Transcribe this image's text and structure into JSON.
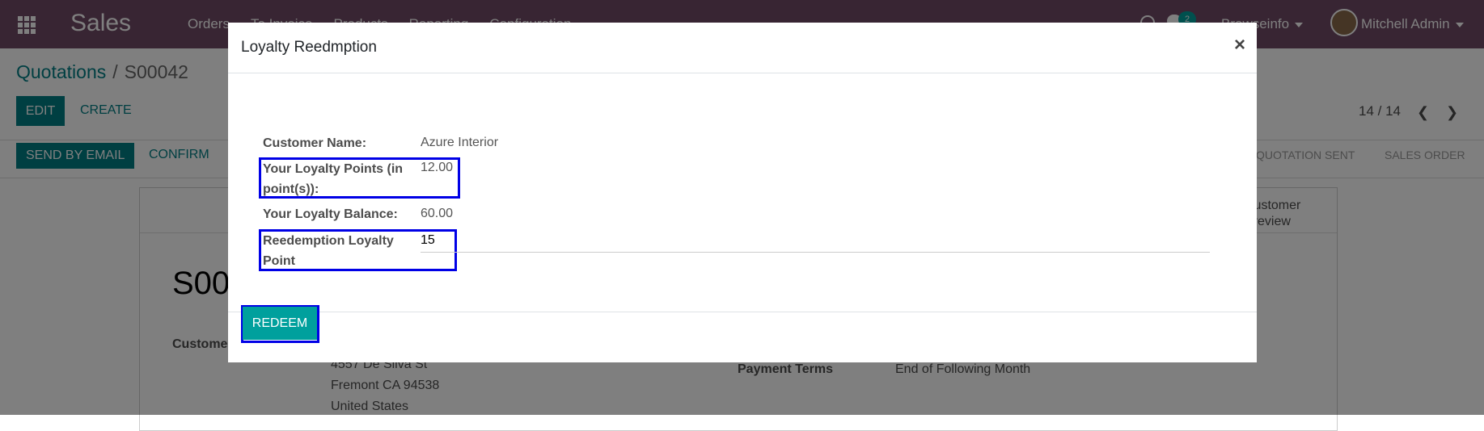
{
  "navbar": {
    "brand": "Sales",
    "menu": [
      "Orders",
      "To Invoice",
      "Products",
      "Reporting",
      "Configuration"
    ],
    "chat_badge": "2",
    "company": "Browseinfo",
    "user": "Mitchell Admin"
  },
  "page": {
    "breadcrumb_parent": "Quotations",
    "breadcrumb_sep": "/",
    "breadcrumb_current": "S00042",
    "edit_label": "EDIT",
    "create_label": "CREATE",
    "pager": "14 / 14",
    "send_email_label": "SEND BY EMAIL",
    "confirm_label": "CONFIRM",
    "stage_sent": "QUOTATION SENT",
    "stage_order": "SALES ORDER",
    "customer_preview": "Customer\nPreview",
    "so_title": "S00",
    "customer_label": "Custome",
    "address_lines": [
      "4557 De Silva St",
      "Fremont CA 94538",
      "United States"
    ],
    "payment_terms_label": "Payment Terms",
    "payment_terms_value": "End of Following Month"
  },
  "modal": {
    "title": "Loyalty Reedmption",
    "close": "×",
    "customer_name_label": "Customer Name:",
    "customer_name_value": "Azure Interior",
    "points_label_line1": "Your Loyalty Points (in",
    "points_label_line2": "point(s)):",
    "points_value": "12.00",
    "balance_label": "Your Loyalty Balance:",
    "balance_value": "60.00",
    "redeem_point_label_line1": "Reedemption Loyalty",
    "redeem_point_label_line2": "Point",
    "redeem_point_value": "15",
    "redeem_button": "REDEEM"
  },
  "colors": {
    "navbar": "#714b67",
    "primary": "#017e84",
    "redeem": "#00a09d",
    "highlight": "#0000e6"
  }
}
